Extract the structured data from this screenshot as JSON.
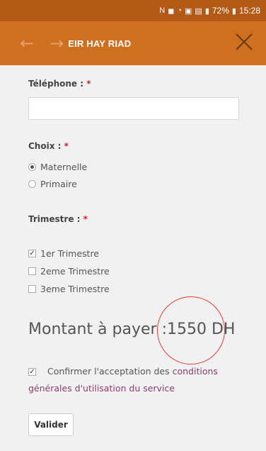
{
  "status_bar": {
    "battery": "72%",
    "time": "15:28",
    "icons": [
      "nfc-icon",
      "mute-icon",
      "wifi-icon",
      "data-icon",
      "image-icon",
      "signal-icon",
      "battery-icon"
    ]
  },
  "app_bar": {
    "title": "EIR HAY RIAD",
    "back_icon": "arrow-left-icon",
    "forward_icon": "arrow-right-icon",
    "close_icon": "close-icon",
    "color": "#cf7021"
  },
  "form": {
    "telephone": {
      "label": "Téléphone :",
      "required": "*",
      "value": ""
    },
    "choix": {
      "label": "Choix :",
      "required": "*",
      "options": [
        {
          "label": "Maternelle",
          "selected": true
        },
        {
          "label": "Primaire",
          "selected": false
        }
      ]
    },
    "trimestre": {
      "label": "Trimestre :",
      "required": "*",
      "options": [
        {
          "label": "1er Trimestre",
          "checked": true
        },
        {
          "label": "2eme Trimestre",
          "checked": false
        },
        {
          "label": "3eme Trimestre",
          "checked": false
        }
      ]
    },
    "amount": {
      "label": "Montant à payer :",
      "value": "1550 DH"
    },
    "confirm": {
      "checked": true,
      "text": "Confirmer l'acceptation des ",
      "link": "conditions générales d'utilisation du service"
    },
    "submit_label": "Valider"
  }
}
